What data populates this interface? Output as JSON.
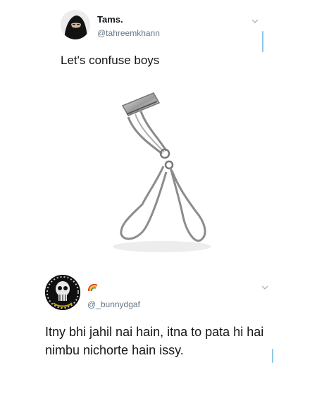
{
  "tweet1": {
    "author": {
      "display_name": "Tams.",
      "handle": "@tahreemkhann"
    },
    "text": "Let's confuse boys",
    "media": {
      "description_icon": "eyelash-curler-image"
    },
    "menu_icon": "chevron-down-icon"
  },
  "tweet2": {
    "author": {
      "display_name_emoji": "rainbow-emoji",
      "handle": "@_bunnydgaf"
    },
    "text": "Itny bhi jahil nai hain, itna to pata hi hai nimbu nichorte hain issy.",
    "menu_icon": "chevron-down-icon"
  },
  "colors": {
    "background": "#ffffff",
    "text": "#14171a",
    "secondary": "#657786",
    "accent": "#8fc6ea"
  }
}
